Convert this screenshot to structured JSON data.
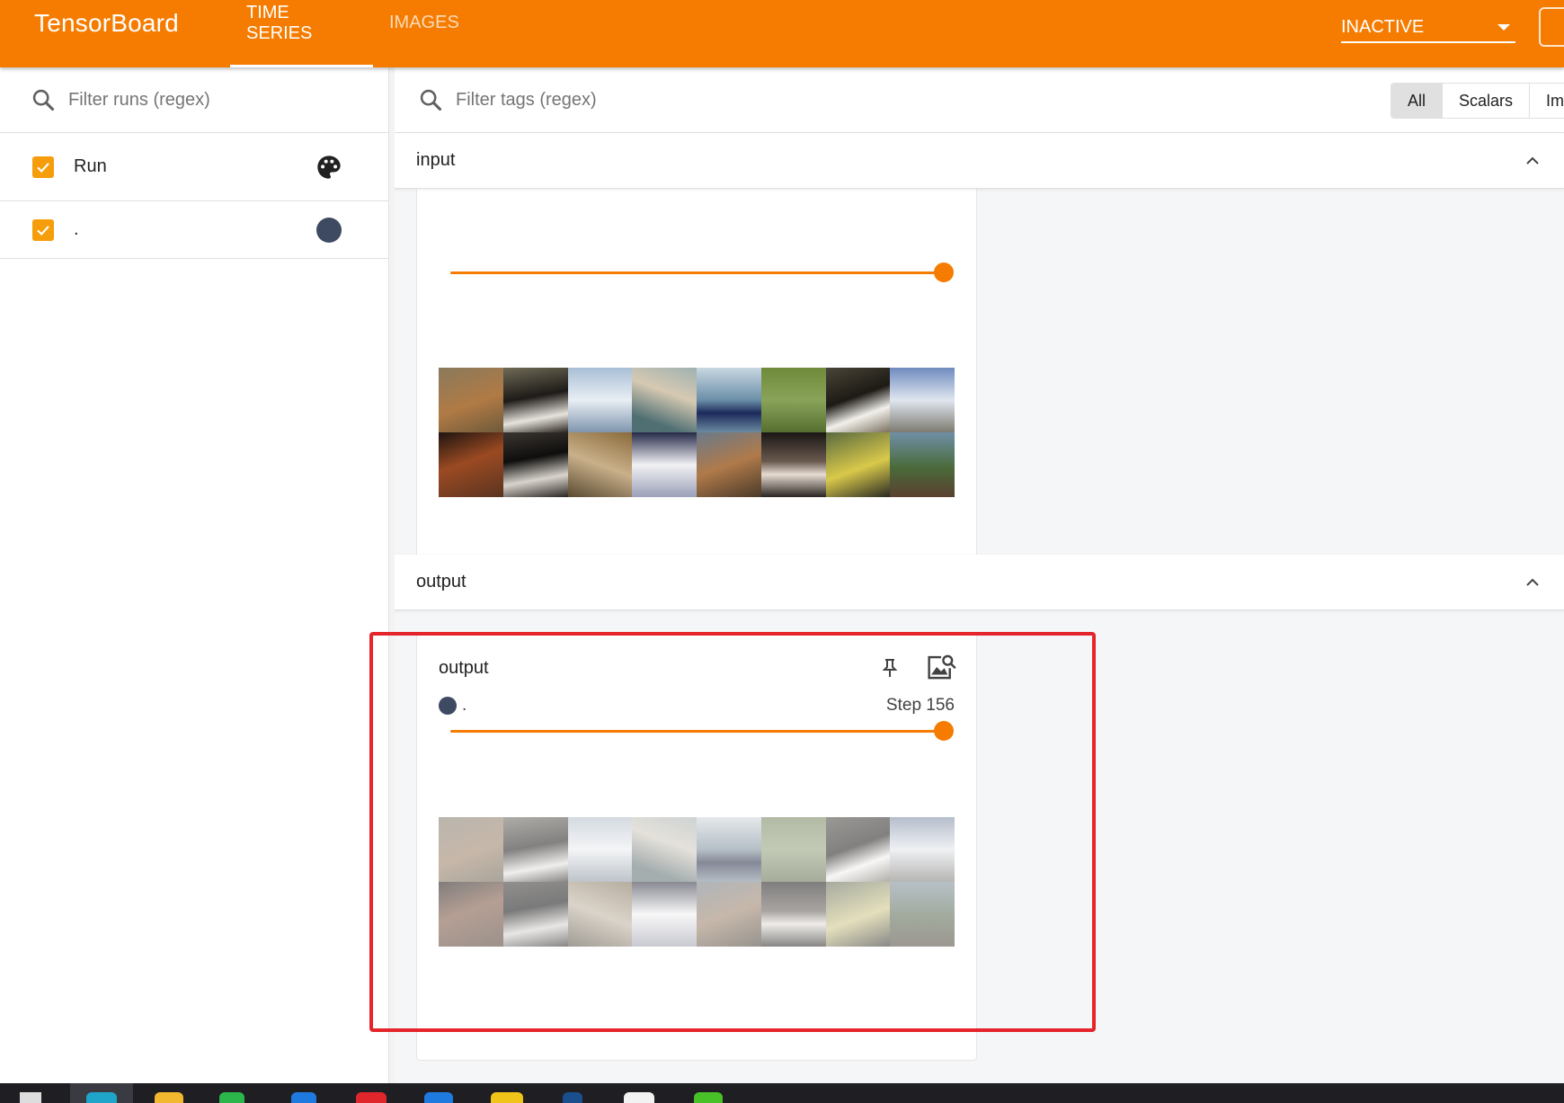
{
  "header": {
    "brand": "TensorBoard",
    "tabs": [
      {
        "label": "TIME SERIES",
        "active": true
      },
      {
        "label": "IMAGES",
        "active": false
      }
    ],
    "status_select": "INACTIVE",
    "accent_color": "#f57c00"
  },
  "sidebar": {
    "filter_placeholder": "Filter runs (regex)",
    "runs": [
      {
        "label": "Run",
        "checked": true,
        "icon": "palette-icon"
      },
      {
        "label": ".",
        "checked": true,
        "color": "#3e4a61"
      }
    ]
  },
  "main": {
    "tag_filter_placeholder": "Filter tags (regex)",
    "type_filters": [
      "All",
      "Scalars",
      "Im"
    ],
    "selected_type_filter": "All",
    "groups": [
      {
        "name": "input",
        "card": {
          "slider_value": 1.0
        }
      },
      {
        "name": "output",
        "card": {
          "title": "output",
          "run_label": ".",
          "step_label": "Step 156",
          "slider_value": 1.0
        }
      }
    ]
  }
}
